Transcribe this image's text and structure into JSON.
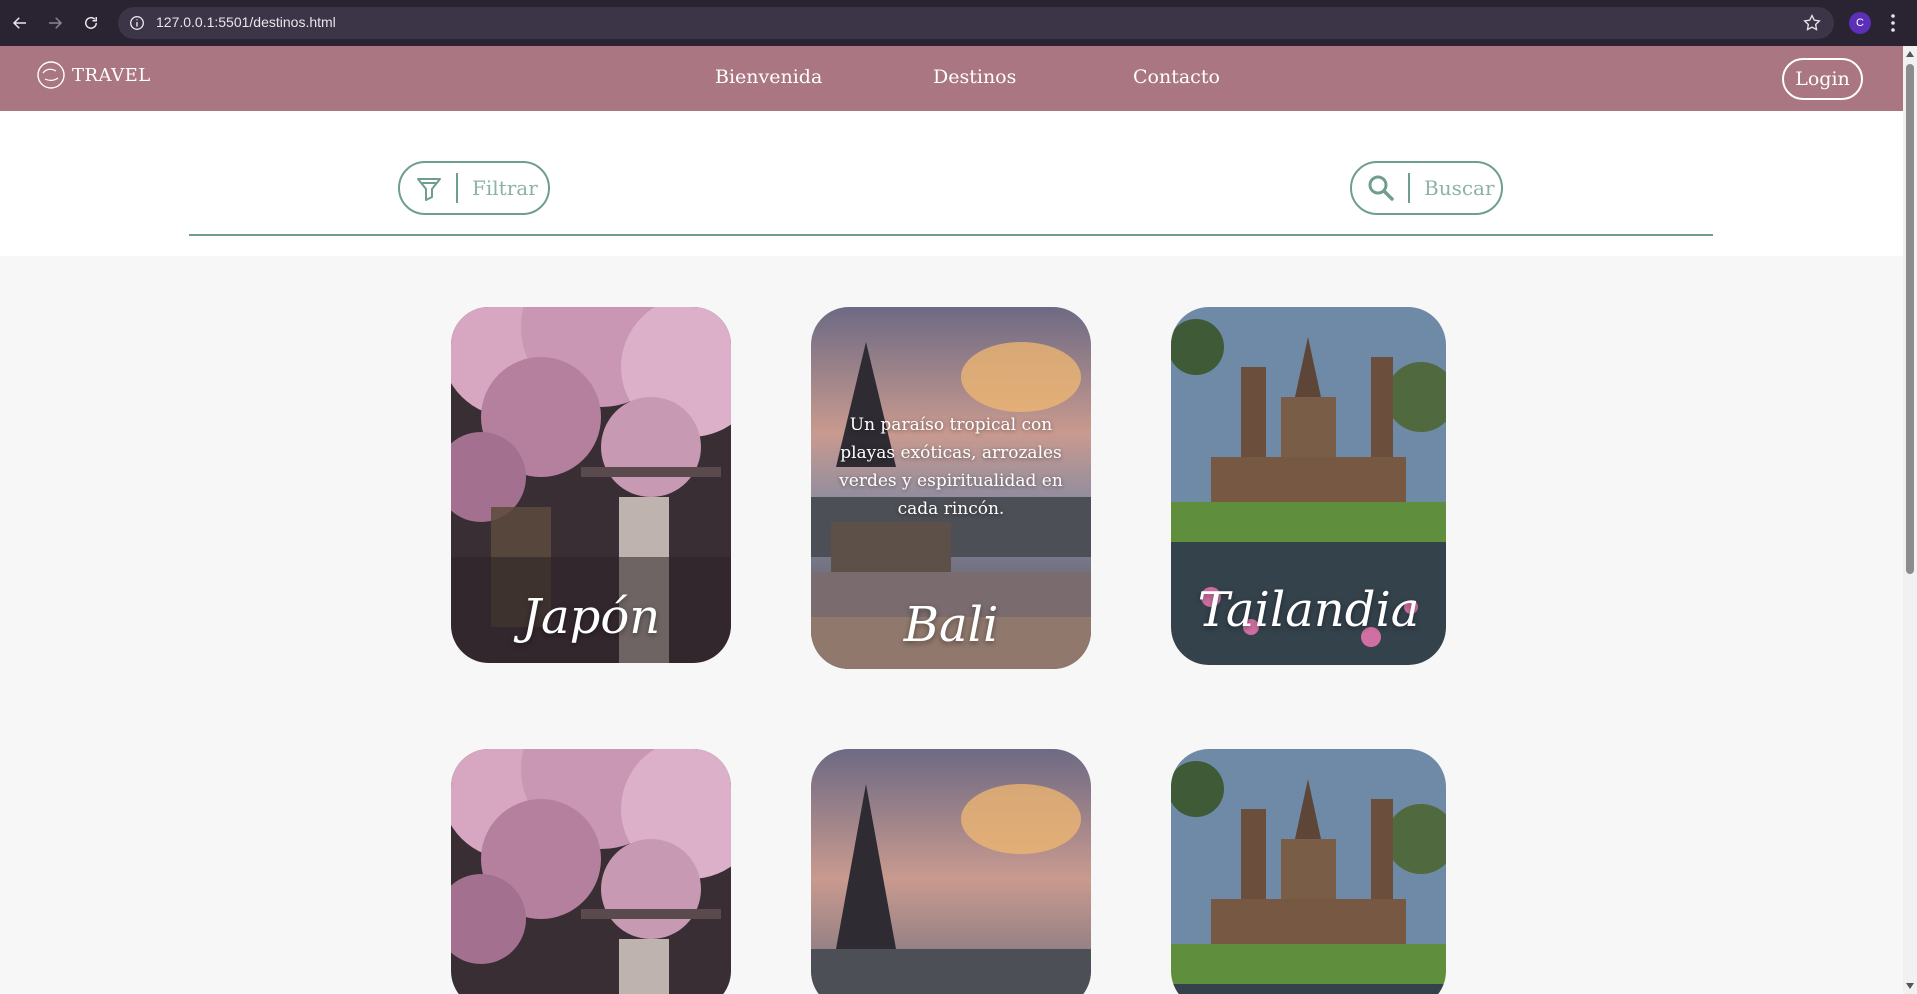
{
  "browser": {
    "url": "127.0.0.1:5501/destinos.html",
    "profile_initial": "C"
  },
  "header": {
    "brand": "TRAVEL",
    "nav": [
      "Bienvenida",
      "Destinos",
      "Contacto"
    ],
    "login_label": "Login",
    "color": "#a97681"
  },
  "toolbar": {
    "filter_label": "Filtrar",
    "search_label": "Buscar",
    "accent": "#6e9e8e"
  },
  "cards": [
    {
      "title": "Japón",
      "description": ""
    },
    {
      "title": "Bali",
      "description": "Un paraíso tropical con playas exóticas, arrozales verdes y espiritualidad en cada rincón."
    },
    {
      "title": "Tailandia",
      "description": ""
    },
    {
      "title": "",
      "description": ""
    },
    {
      "title": "",
      "description": ""
    },
    {
      "title": "",
      "description": ""
    }
  ]
}
